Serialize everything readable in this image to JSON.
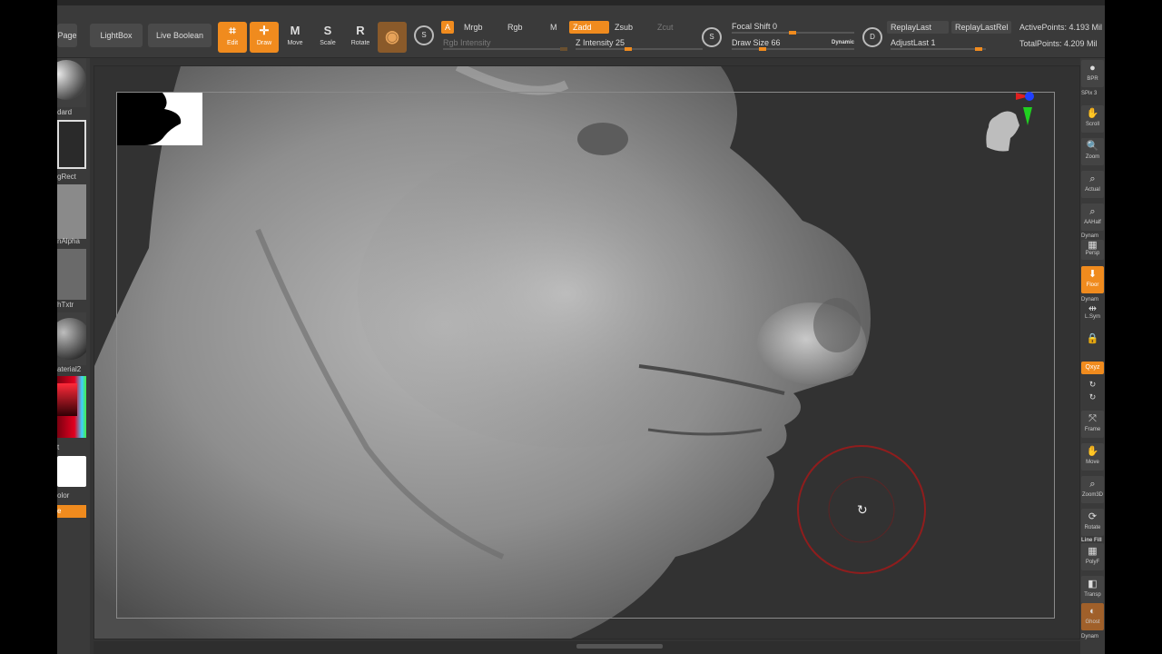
{
  "colors": {
    "accent": "#f08b1e",
    "background": "#333333",
    "panel": "#3a3a3a",
    "brush_ring": "#8f1d1d"
  },
  "toolbar": {
    "page_label": "Page",
    "lightbox_label": "LightBox",
    "live_boolean_label": "Live Boolean",
    "edit_label": "Edit",
    "draw_label": "Draw",
    "move_label": "Move",
    "scale_label": "Scale",
    "rotate_label": "Rotate",
    "a_label": "A",
    "mrgb_label": "Mrgb",
    "rgb_label": "Rgb",
    "m_label": "M",
    "zadd_label": "Zadd",
    "zsub_label": "Zsub",
    "zcut_label": "Zcut",
    "rgb_intensity_label": "Rgb Intensity",
    "z_intensity_label": "Z Intensity 25",
    "z_intensity_value": 25,
    "focal_shift_label": "Focal Shift 0",
    "focal_shift_value": 0,
    "draw_size_label": "Draw Size 66",
    "draw_size_value": 66,
    "dynamic_label": "Dynamic",
    "replay_last_label": "ReplayLast",
    "replay_last_rel_label": "ReplayLastRel",
    "adjust_last_label": "AdjustLast 1",
    "active_points": "ActivePoints: 4.193 Mil",
    "total_points": "TotalPoints: 4.209 Mil"
  },
  "left_shelf": {
    "standard_label": "dard",
    "rect_label": "gRect",
    "alpha_label": "nAlpha",
    "texture_label": "hTxtr",
    "material_label": "aterial2",
    "gradient_label": "t",
    "color_label": "olor",
    "orange_label": "e"
  },
  "right_shelf": {
    "bpr": "BPR",
    "spix": "SPix 3",
    "scroll": "Scroll",
    "zoom": "Zoom",
    "actual": "Actual",
    "aahalf": "AAHalf",
    "dynamic1": "Dynam",
    "persp": "Persp",
    "floor": "Floor",
    "dynamic2": "Dynam",
    "lsym": "L.Sym",
    "xyz": "Qxyz",
    "frame": "Frame",
    "move": "Move",
    "zoom3d": "Zoom3D",
    "rotate": "Rotate",
    "line_fill": "Line Fill",
    "polyf": "PolyF",
    "transp": "Transp",
    "ghost": "Ghost",
    "dynamic3": "Dynam"
  }
}
